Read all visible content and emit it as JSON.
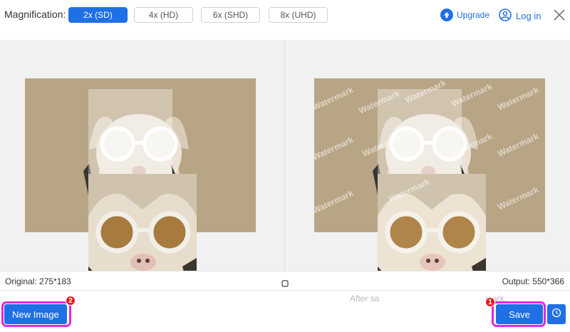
{
  "toolbar": {
    "magnification_label": "Magnification:",
    "options": [
      "2x (SD)",
      "4x (HD)",
      "6x (SHD)",
      "8x (UHD)"
    ],
    "selected": "2x (SD)",
    "upgrade_label": "Upgrade",
    "login_label": "Log in"
  },
  "preview": {
    "watermark_text": "Watermark",
    "hint_left": "After sa",
    "hint_right": "mark."
  },
  "status": {
    "original_label": "Original: 275*183",
    "output_label": "Output: 550*366"
  },
  "actions": {
    "new_image_label": "New Image",
    "new_image_badge": "2",
    "save_label": "Save",
    "save_badge": "1"
  },
  "colors": {
    "accent": "#1f6fe5",
    "highlight": "#e227e2",
    "badge": "#e31b1b",
    "photo_bg": "#b8a585"
  },
  "icons": [
    "upgrade-arrow-icon",
    "user-icon",
    "close-icon",
    "compare-icon",
    "history-clock-icon"
  ]
}
